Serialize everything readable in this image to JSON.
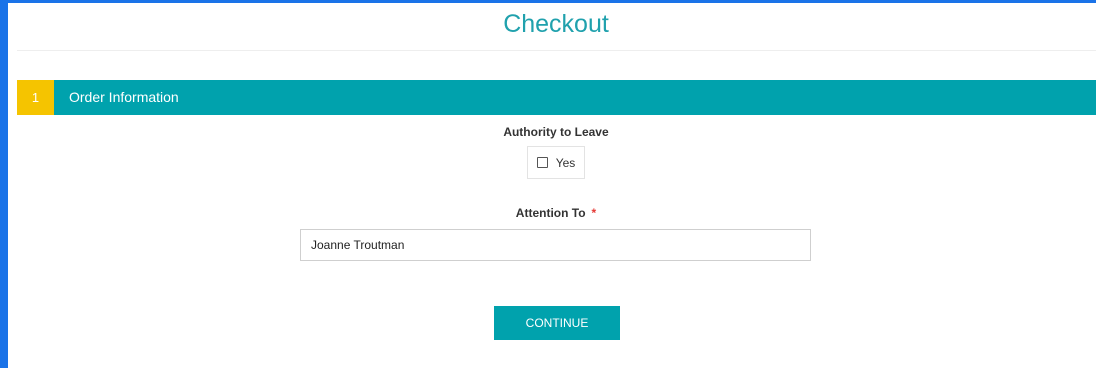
{
  "page": {
    "title": "Checkout"
  },
  "step": {
    "number": "1",
    "label": "Order Information"
  },
  "authority": {
    "label": "Authority to Leave",
    "option_label": "Yes",
    "checked": false
  },
  "attention": {
    "label": "Attention To",
    "required_marker": "*",
    "value": "Joanne Troutman"
  },
  "actions": {
    "continue_label": "CONTINUE"
  },
  "colors": {
    "accent": "#00a2ad",
    "step_badge": "#f5c400",
    "title": "#20a1ad",
    "required": "#e53935",
    "window_frame": "#1a73e8"
  }
}
